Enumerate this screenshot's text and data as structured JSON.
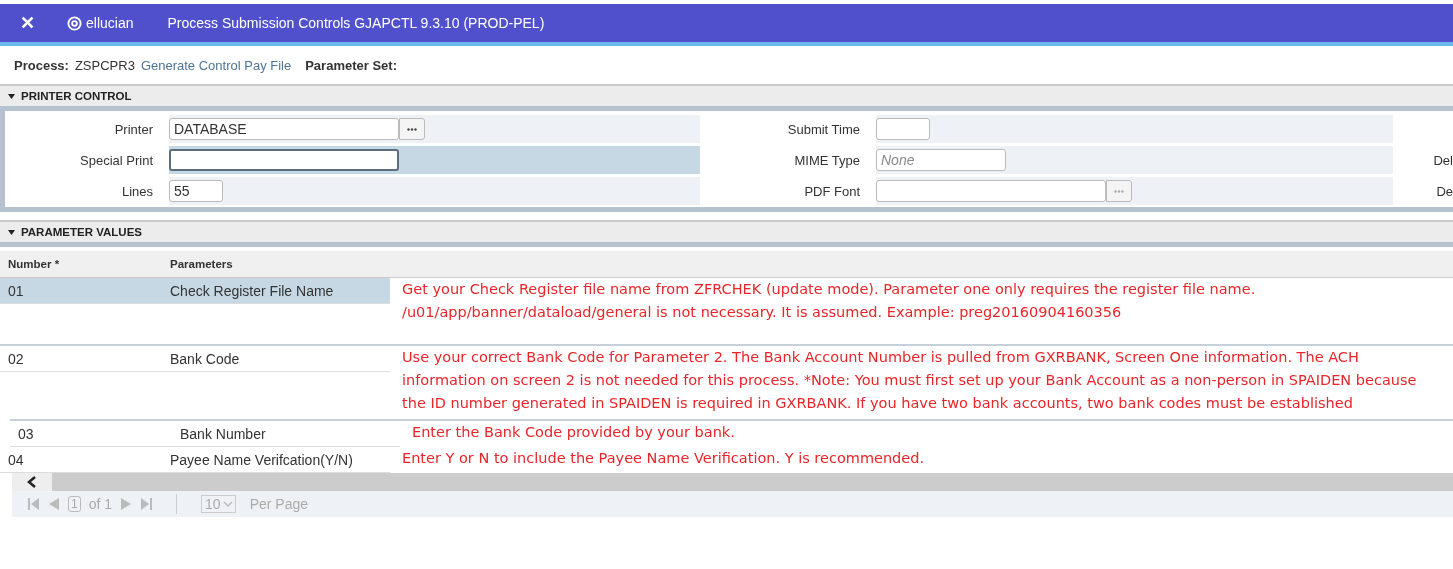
{
  "header": {
    "close": "✕",
    "brand": "ellucian",
    "title": "Process Submission Controls GJAPCTL 9.3.10 (PROD-PEL)"
  },
  "process": {
    "label": "Process:",
    "code": "ZSPCPR3",
    "name": "Generate Control Pay File",
    "parameter_set_label": "Parameter Set:"
  },
  "printer_control": {
    "title": "PRINTER CONTROL",
    "expanded": true,
    "fields": [
      {
        "label": "Printer",
        "value": "DATABASE",
        "kind": "lookup",
        "focused": false
      },
      {
        "label": "Special Print",
        "kind": "text",
        "focused": true
      },
      {
        "label": "Lines",
        "value": "55",
        "kind": "short",
        "focused": false
      }
    ],
    "fields_2": [
      {
        "label": "Submit Time",
        "kind": "short"
      },
      {
        "label": "MIME Type",
        "placeholder": "None",
        "kind": "text"
      },
      {
        "label": "PDF Font",
        "kind": "lookup"
      }
    ],
    "column_3_labels": [
      "Del",
      "De"
    ]
  },
  "parameter_values": {
    "title": "PARAMETER VALUES",
    "expanded": true,
    "columns": [
      "Number *",
      "Parameters"
    ],
    "rows": [
      {
        "number": "01",
        "parameter": "Check Register File Name",
        "selected": true,
        "note": "Get your Check Register file name from ZFRCHEK (update mode).  Parameter one only requires the register file name.  /u01/app/banner/dataload/general is not necessary.  It is assumed.    Example:  preg20160904160356"
      },
      {
        "number": "02",
        "parameter": "Bank Code",
        "selected": false,
        "note": "Use your correct Bank Code for Parameter 2.   The Bank Account Number is pulled from GXRBANK, Screen One information.  The ACH information on screen 2 is not needed for this process.  *Note:  You must first set up your Bank Account as a non-person in SPAIDEN because the ID number generated in SPAIDEN is required in GXRBANK.   If you have two bank accounts, two bank codes must be established"
      },
      {
        "number": "03",
        "parameter": "Bank Number",
        "selected": false,
        "note": "Enter the Bank Code provided by your bank."
      },
      {
        "number": "04",
        "parameter": "Payee Name Verifcation(Y/N)",
        "selected": false,
        "note": "Enter Y or N to include the Payee Name Verification.  Y is recommended."
      }
    ],
    "pager": {
      "page": "1",
      "of": "of 1",
      "per_page": "10",
      "per_page_label": "Per Page"
    }
  }
}
